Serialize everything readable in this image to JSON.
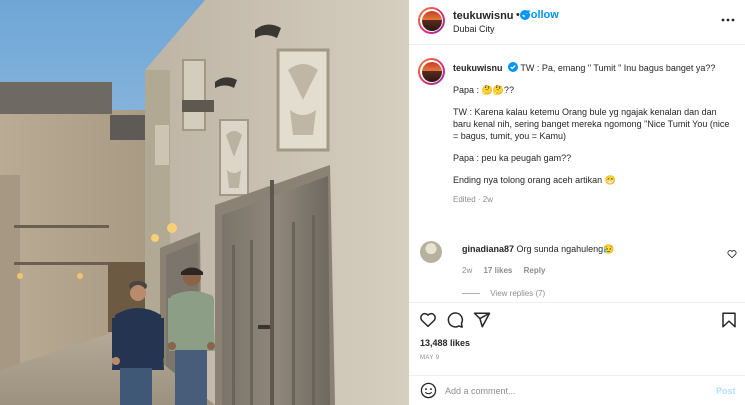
{
  "post": {
    "username": "teukuwisnu",
    "follow_label": "Follow",
    "separator": "•",
    "location": "Dubai City"
  },
  "caption": {
    "username": "teukuwisnu",
    "lines": [
      "TW : Pa, emang \" Tumit \" Inu bagus banget ya??",
      "Papa : 🤔🤔??",
      "TW : Karena kalau ketemu Orang bule yg ngajak kenalan dan dan baru kenal nih, sering banget mereka ngomong \"Nice Tumit You (nice = bagus, tumit, you = Kamu)",
      "Papa : peu ka peugah gam??",
      "Ending nya tolong orang aceh artikan 😁"
    ],
    "edited": "Edited · 2w"
  },
  "comment": {
    "username": "ginadiana87",
    "text": "Org sunda ngahuleng😥",
    "age": "2w",
    "likes": "17 likes",
    "reply": "Reply",
    "view_replies": "View replies (7)"
  },
  "stats": {
    "likes": "13,488 likes",
    "date": "MAY 9"
  },
  "add_comment": {
    "placeholder": "Add a comment...",
    "post_label": "Post"
  },
  "icons": {
    "header": [
      "verified-badge-icon",
      "more-options-icon"
    ],
    "actions": [
      "heart-icon",
      "comment-icon",
      "share-icon",
      "bookmark-icon"
    ],
    "composer": "emoji-icon"
  },
  "colors": {
    "accent": "#0095f6",
    "muted": "#8e8e8e",
    "text": "#262626",
    "post_disabled": "#b2dffc"
  }
}
